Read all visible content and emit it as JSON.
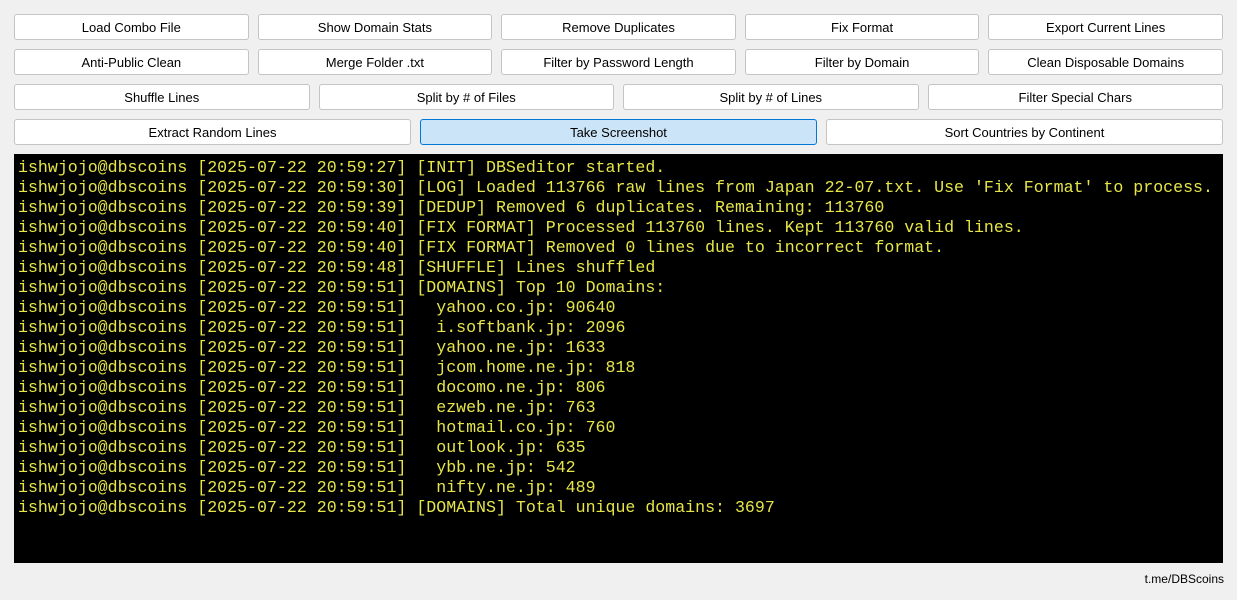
{
  "toolbar": {
    "row1": [
      {
        "name": "load-combo-file-button",
        "label": "Load Combo File"
      },
      {
        "name": "show-domain-stats-button",
        "label": "Show Domain Stats"
      },
      {
        "name": "remove-duplicates-button",
        "label": "Remove Duplicates"
      },
      {
        "name": "fix-format-button",
        "label": "Fix Format"
      },
      {
        "name": "export-current-lines-button",
        "label": "Export Current Lines"
      }
    ],
    "row2": [
      {
        "name": "anti-public-clean-button",
        "label": "Anti-Public Clean"
      },
      {
        "name": "merge-folder-txt-button",
        "label": "Merge Folder .txt"
      },
      {
        "name": "filter-by-password-length-button",
        "label": "Filter by Password Length"
      },
      {
        "name": "filter-by-domain-button",
        "label": "Filter by Domain"
      },
      {
        "name": "clean-disposable-domains-button",
        "label": "Clean Disposable Domains"
      }
    ],
    "row3": [
      {
        "name": "shuffle-lines-button",
        "label": "Shuffle Lines"
      },
      {
        "name": "split-by-files-button",
        "label": "Split by # of Files"
      },
      {
        "name": "split-by-lines-button",
        "label": "Split by # of Lines"
      },
      {
        "name": "filter-special-chars-button",
        "label": "Filter Special Chars"
      }
    ],
    "row4": [
      {
        "name": "extract-random-lines-button",
        "label": "Extract Random Lines"
      },
      {
        "name": "take-screenshot-button",
        "label": "Take Screenshot",
        "active": true
      },
      {
        "name": "sort-countries-by-continent-button",
        "label": "Sort Countries by Continent"
      }
    ]
  },
  "console": {
    "text_color": "#e6e64a",
    "background": "#000000",
    "lines": [
      "ishwjojo@dbscoins [2025-07-22 20:59:27] [INIT] DBSeditor started.",
      "ishwjojo@dbscoins [2025-07-22 20:59:30] [LOG] Loaded 113766 raw lines from Japan 22-07.txt. Use 'Fix Format' to process.",
      "ishwjojo@dbscoins [2025-07-22 20:59:39] [DEDUP] Removed 6 duplicates. Remaining: 113760",
      "ishwjojo@dbscoins [2025-07-22 20:59:40] [FIX FORMAT] Processed 113760 lines. Kept 113760 valid lines.",
      "ishwjojo@dbscoins [2025-07-22 20:59:40] [FIX FORMAT] Removed 0 lines due to incorrect format.",
      "ishwjojo@dbscoins [2025-07-22 20:59:48] [SHUFFLE] Lines shuffled",
      "ishwjojo@dbscoins [2025-07-22 20:59:51] [DOMAINS] Top 10 Domains:",
      "ishwjojo@dbscoins [2025-07-22 20:59:51]   yahoo.co.jp: 90640",
      "ishwjojo@dbscoins [2025-07-22 20:59:51]   i.softbank.jp: 2096",
      "ishwjojo@dbscoins [2025-07-22 20:59:51]   yahoo.ne.jp: 1633",
      "ishwjojo@dbscoins [2025-07-22 20:59:51]   jcom.home.ne.jp: 818",
      "ishwjojo@dbscoins [2025-07-22 20:59:51]   docomo.ne.jp: 806",
      "ishwjojo@dbscoins [2025-07-22 20:59:51]   ezweb.ne.jp: 763",
      "ishwjojo@dbscoins [2025-07-22 20:59:51]   hotmail.co.jp: 760",
      "ishwjojo@dbscoins [2025-07-22 20:59:51]   outlook.jp: 635",
      "ishwjojo@dbscoins [2025-07-22 20:59:51]   ybb.ne.jp: 542",
      "ishwjojo@dbscoins [2025-07-22 20:59:51]   nifty.ne.jp: 489",
      "ishwjojo@dbscoins [2025-07-22 20:59:51] [DOMAINS] Total unique domains: 3697"
    ]
  },
  "footer": {
    "link": "t.me/DBScoins"
  }
}
